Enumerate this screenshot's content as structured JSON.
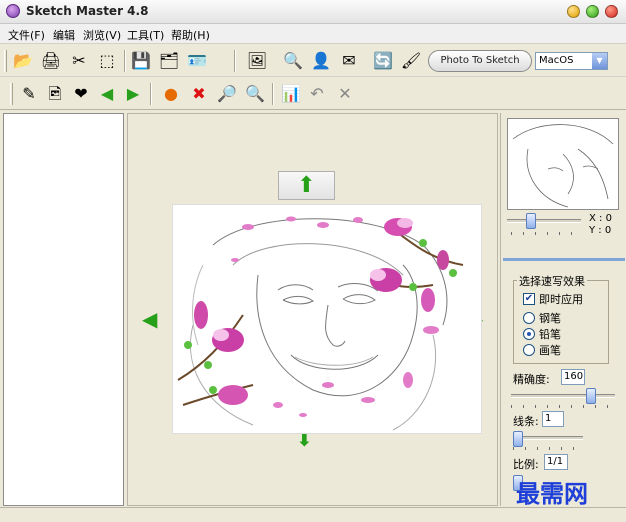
{
  "window": {
    "title": "Sketch Master 4.8"
  },
  "menu": [
    {
      "label": "文件(F)"
    },
    {
      "label": "编辑"
    },
    {
      "label": "浏览(V)"
    },
    {
      "label": "工具(T)"
    },
    {
      "label": "帮助(H)"
    }
  ],
  "toolbar": {
    "photo_to_sketch_label": "Photo To Sketch",
    "style_select_value": "MacOS"
  },
  "preview": {
    "x_label": "X : 0",
    "y_label": "Y : 0",
    "zoom_level": 0.3
  },
  "effects": {
    "group_title": "选择速写效果",
    "apply_now": {
      "label": "即时应用",
      "checked": true
    },
    "options": [
      {
        "label": "钢笔",
        "selected": false
      },
      {
        "label": "铅笔",
        "selected": true
      },
      {
        "label": "画笔",
        "selected": false
      }
    ]
  },
  "settings": {
    "precision_label": "精确度:",
    "precision_value": "160",
    "precision_level": 0.8,
    "lines_label": "线条:",
    "lines_value": "1",
    "lines_level": 0.0,
    "ratio_label": "比例:",
    "ratio_value": "1/1"
  },
  "watermark": "最需网",
  "icons": [
    "open-folder-icon",
    "scanner-icon",
    "tools-icon",
    "export-icon",
    "save-icon",
    "save-all-icon",
    "contact-card-icon",
    "scan-photo-icon",
    "zoom-icon",
    "card-icon",
    "email-icon",
    "rotate-icon",
    "brush-icon",
    "edit-icon",
    "image-icon",
    "heart-add-icon",
    "back-arrow-icon",
    "forward-arrow-icon",
    "red-dot-icon",
    "delete-icon",
    "zoom-in-icon",
    "zoom-out-icon",
    "chart-icon",
    "undo-icon",
    "cancel-icon"
  ]
}
